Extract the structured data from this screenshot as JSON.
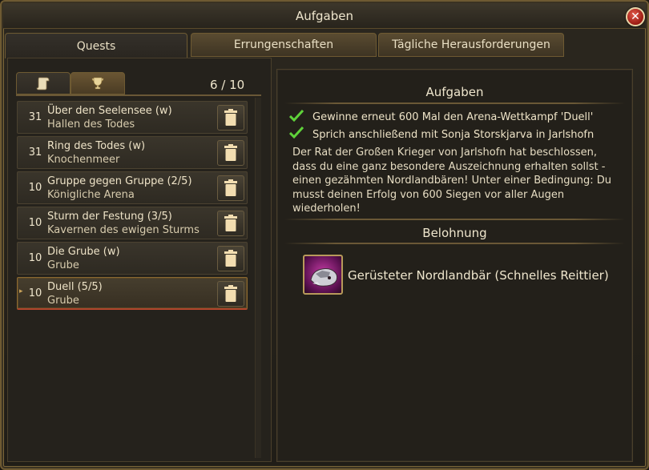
{
  "window": {
    "title": "Aufgaben"
  },
  "tabs": [
    {
      "label": "Quests",
      "active": true
    },
    {
      "label": "Errungenschaften",
      "active": false
    },
    {
      "label": "Tägliche Herausforderungen",
      "active": false
    }
  ],
  "subtabs": {
    "scroll_icon": "scroll-icon",
    "trophy_icon": "trophy-icon",
    "counter": "6 / 10"
  },
  "quests": [
    {
      "level": "31",
      "name": "Über den Seelensee (w)",
      "zone": "Hallen des Todes",
      "selected": false
    },
    {
      "level": "31",
      "name": "Ring des Todes (w)",
      "zone": "Knochenmeer",
      "selected": false
    },
    {
      "level": "10",
      "name": "Gruppe gegen Gruppe (2/5)",
      "zone": "Königliche Arena",
      "selected": false
    },
    {
      "level": "10",
      "name": "Sturm der Festung (3/5)",
      "zone": "Kavernen des ewigen Sturms",
      "selected": false
    },
    {
      "level": "10",
      "name": "Die Grube (w)",
      "zone": "Grube",
      "selected": false
    },
    {
      "level": "10",
      "name": "Duell (5/5)",
      "zone": "Grube",
      "selected": true
    }
  ],
  "details": {
    "heading": "Aufgaben",
    "objectives": [
      "Gewinne erneut 600 Mal den Arena-Wettkampf 'Duell'",
      "Sprich anschließend mit Sonja Storskjarva in Jarlshofn"
    ],
    "description": "Der Rat der Großen Krieger von Jarlshofn hat beschlossen, dass du eine ganz besondere Auszeichnung erhalten sollst - einen gezähmten Nordlandbären! Unter einer Bedingung: Du musst deinen Erfolg von 600 Siegen vor aller Augen wiederholen!",
    "reward_heading": "Belohnung",
    "reward_name": "Gerüsteter Nordlandbär (Schnelles Reittier)"
  },
  "colors": {
    "accent": "#6e5a32",
    "text": "#efe6cd",
    "check": "#5fd23a",
    "selected_border": "#b0452c"
  }
}
